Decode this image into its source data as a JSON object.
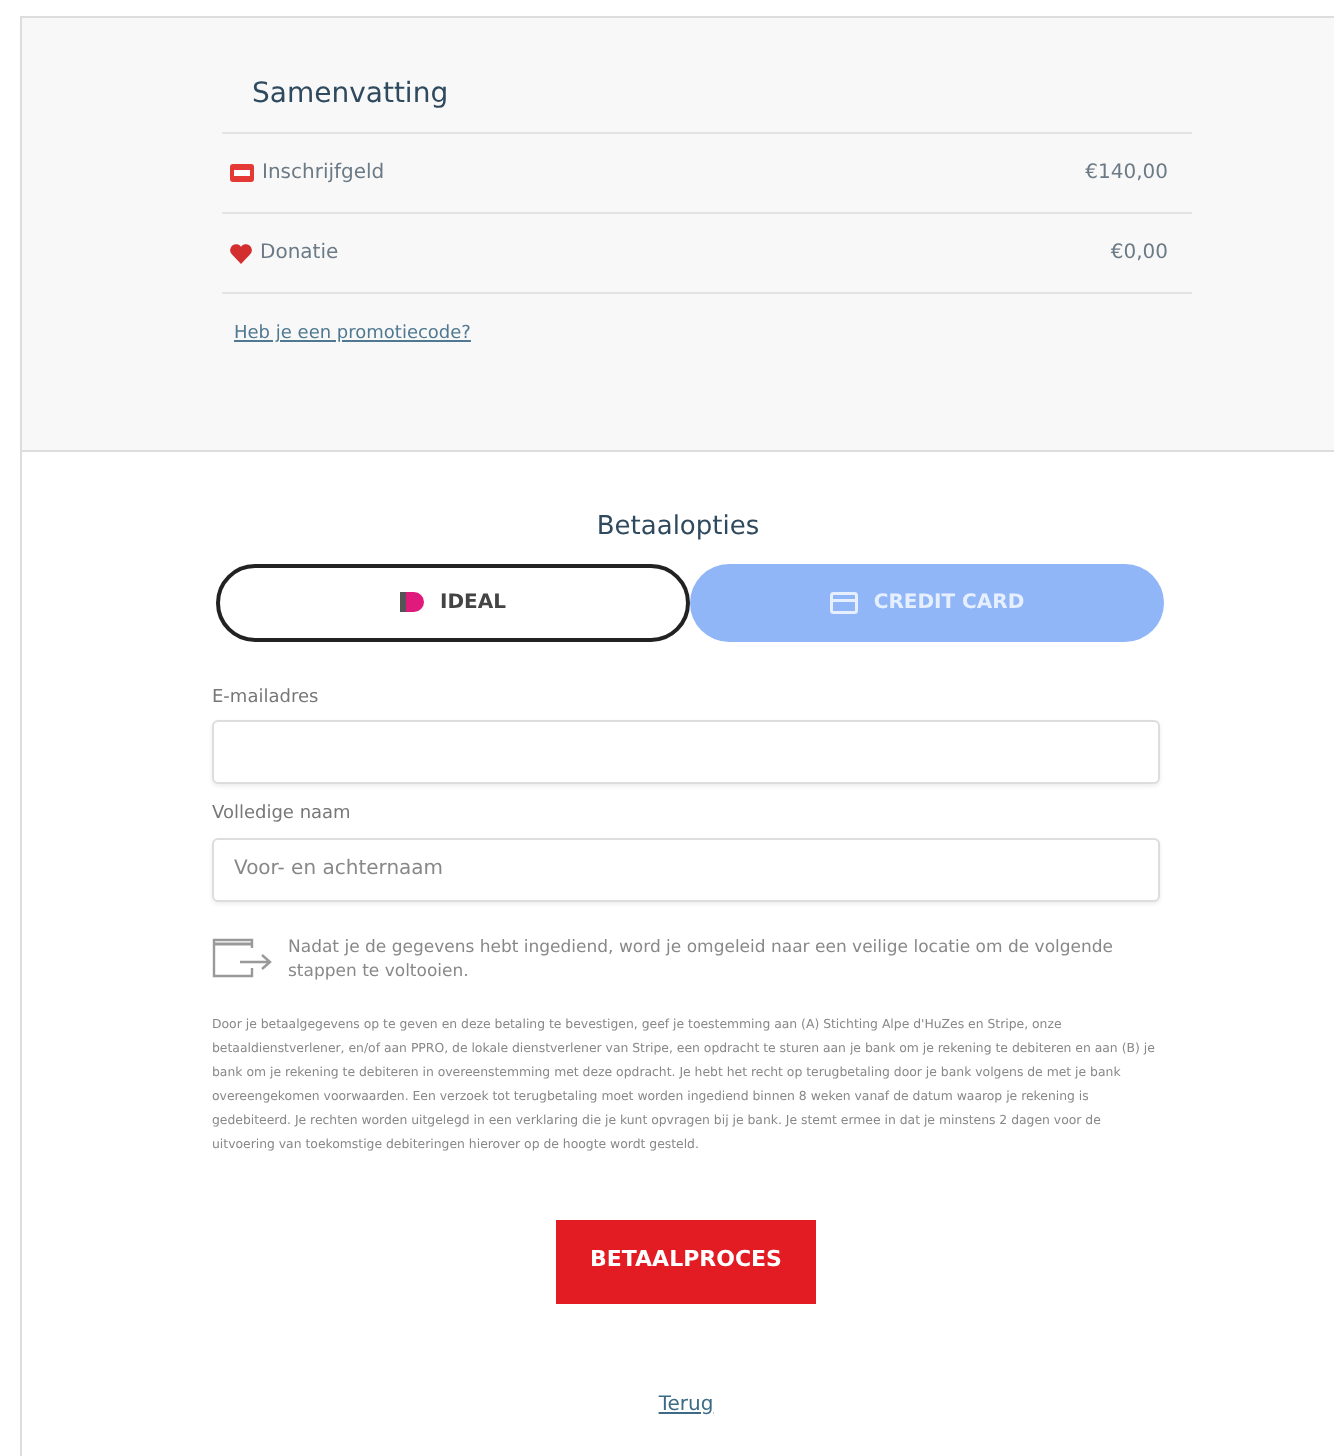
{
  "summary": {
    "title": "Samenvatting",
    "items": [
      {
        "kind": "ticket",
        "label": "Inschrijfgeld",
        "amount": "€140,00"
      },
      {
        "kind": "heart",
        "label": "Donatie",
        "amount": "€0,00"
      }
    ],
    "promo_link": "Heb je een promotiecode?"
  },
  "payment": {
    "title": "Betaalopties",
    "options": [
      {
        "kind": "ideal",
        "label": "IDEAL",
        "selected": true
      },
      {
        "kind": "card",
        "label": "CREDIT CARD",
        "selected": false
      }
    ]
  },
  "form": {
    "fields": [
      {
        "label": "E-mailadres"
      },
      {
        "label": "Volledige naam",
        "placeholder": "Voor- en achternaam"
      }
    ],
    "redirect_note": "Nadat je de gegevens hebt ingediend, word je omgeleid naar een veilige locatie om de volgende stappen te voltooien.",
    "mandate_text": "Door je betaalgegevens op te geven en deze betaling te bevestigen, geef je toestemming aan (A) Stichting Alpe d'HuZes en Stripe, onze betaaldienstverlener, en/of aan PPRO, de lokale dienstverlener van Stripe, een opdracht te sturen aan je bank om je rekening te debiteren en aan (B) je bank om je rekening te debiteren in overeenstemming met deze opdracht. Je hebt het recht op terugbetaling door je bank volgens de met je bank overeengekomen voorwaarden. Een verzoek tot terugbetaling moet worden ingediend binnen 8 weken vanaf de datum waarop je rekening is gedebiteerd. Je rechten worden uitgelegd in een verklaring die je kunt opvragen bij je bank. Je stemt ermee in dat je minstens 2 dagen voor de uitvoering van toekomstige debiteringen hierover op de hoogte wordt gesteld.",
    "submit": "BETAALPROCES",
    "back_link": "Terug"
  }
}
